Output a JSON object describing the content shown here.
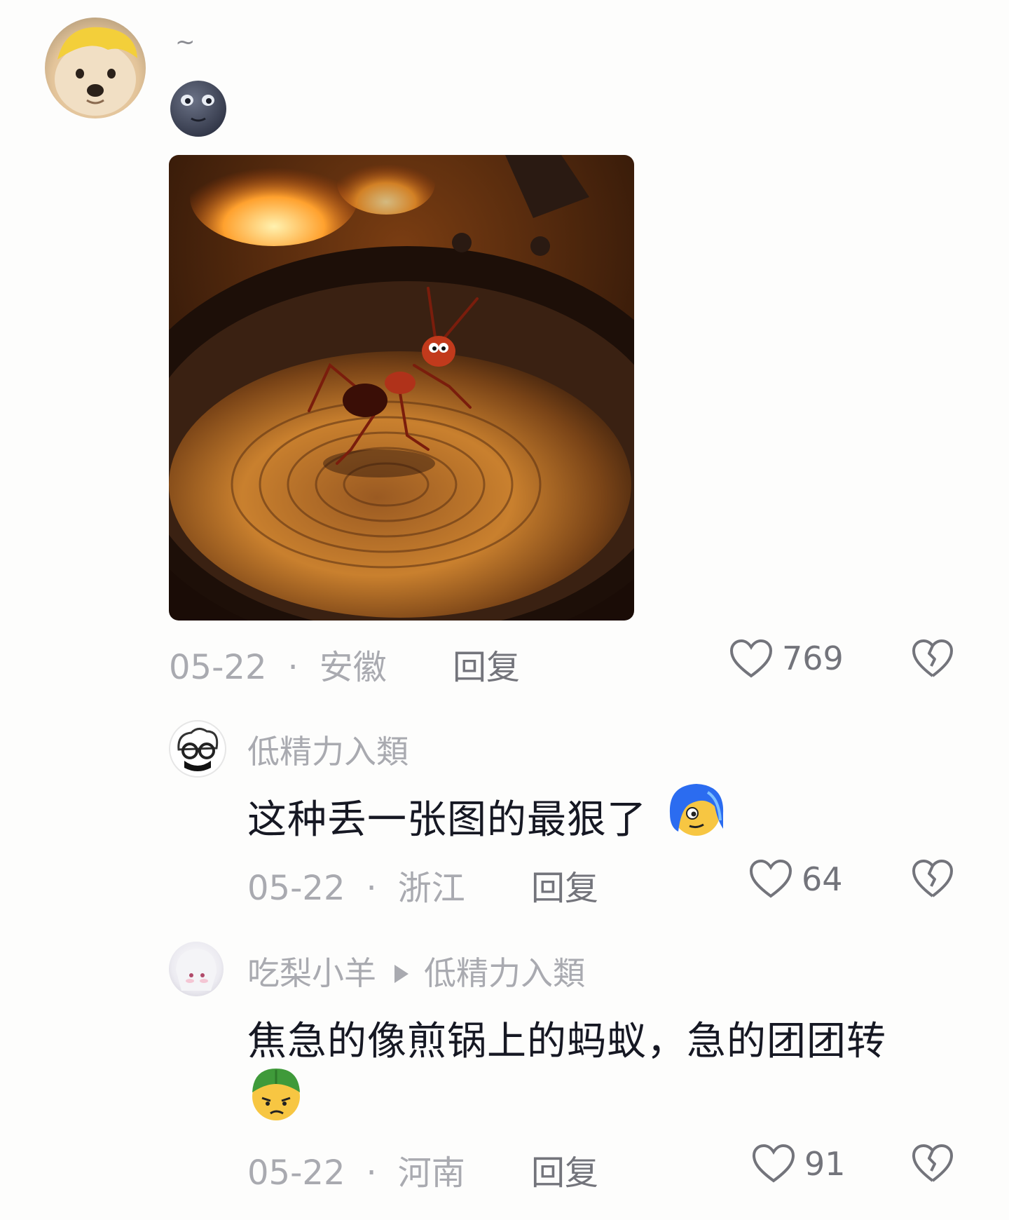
{
  "comment_main": {
    "text": "~",
    "emoji": "moon-face-emoji",
    "image_name": "ant-on-frying-pan-image",
    "date": "05-22",
    "location": "安徽",
    "reply_label": "回复",
    "like_count": "769"
  },
  "reply_1": {
    "username": "低精力入類",
    "text": "这种丢一张图的最狠了",
    "emoji": "blue-hair-face-emoji",
    "date": "05-22",
    "location": "浙江",
    "reply_label": "回复",
    "like_count": "64"
  },
  "reply_2": {
    "username": "吃梨小羊",
    "reply_to": "低精力入類",
    "text_line1": "焦急的像煎锅上的蚂蚁，急的团团转",
    "emoji": "green-hat-face-emoji",
    "date": "05-22",
    "location": "河南",
    "reply_label": "回复",
    "like_count": "91"
  },
  "colors": {
    "background": "#fdfdfc",
    "meta_gray": "#a9aab0",
    "text_dark": "#161823",
    "icon_gray": "#73747b"
  }
}
